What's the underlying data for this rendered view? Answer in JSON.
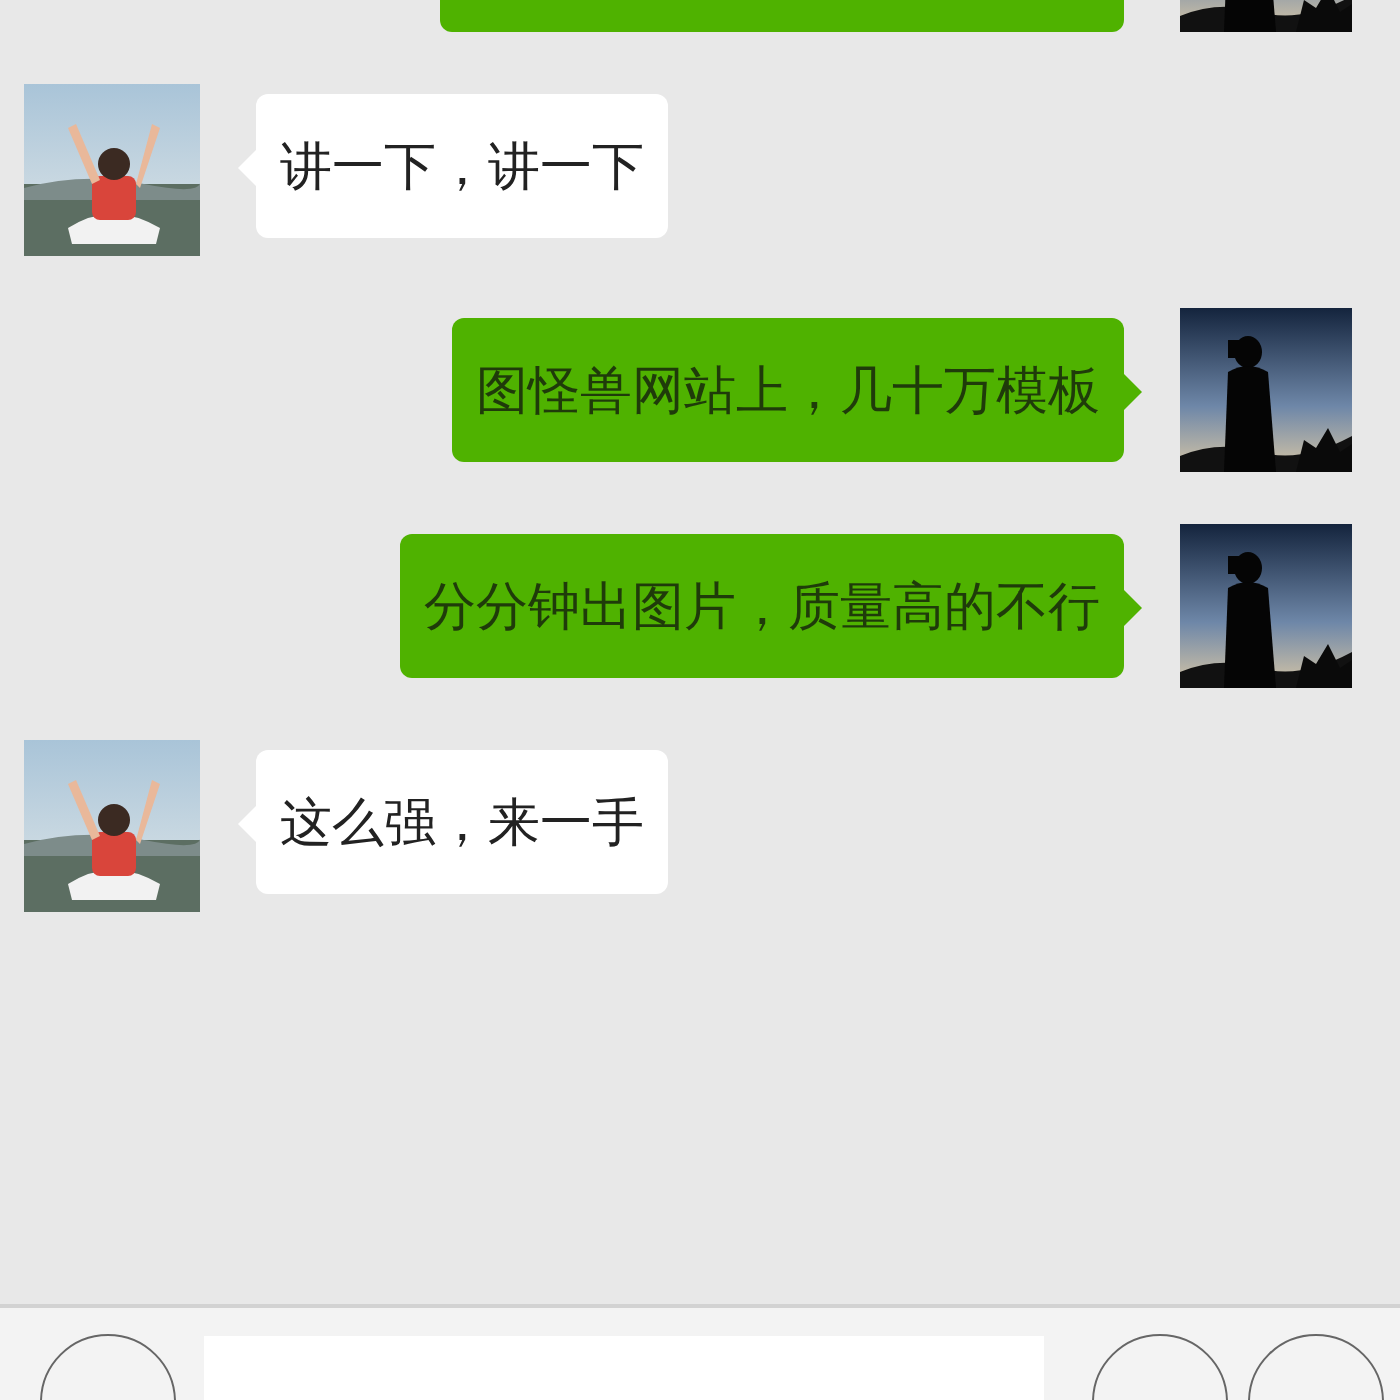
{
  "messages": [
    {
      "kind": "sent"
    },
    {
      "kind": "received",
      "text": "讲一下，讲一下"
    },
    {
      "kind": "sent",
      "text": "图怪兽网站上，几十万模板"
    },
    {
      "kind": "sent",
      "text": "分分钟出图片，质量高的不行"
    },
    {
      "kind": "received",
      "text": "这么强，来一手"
    }
  ]
}
